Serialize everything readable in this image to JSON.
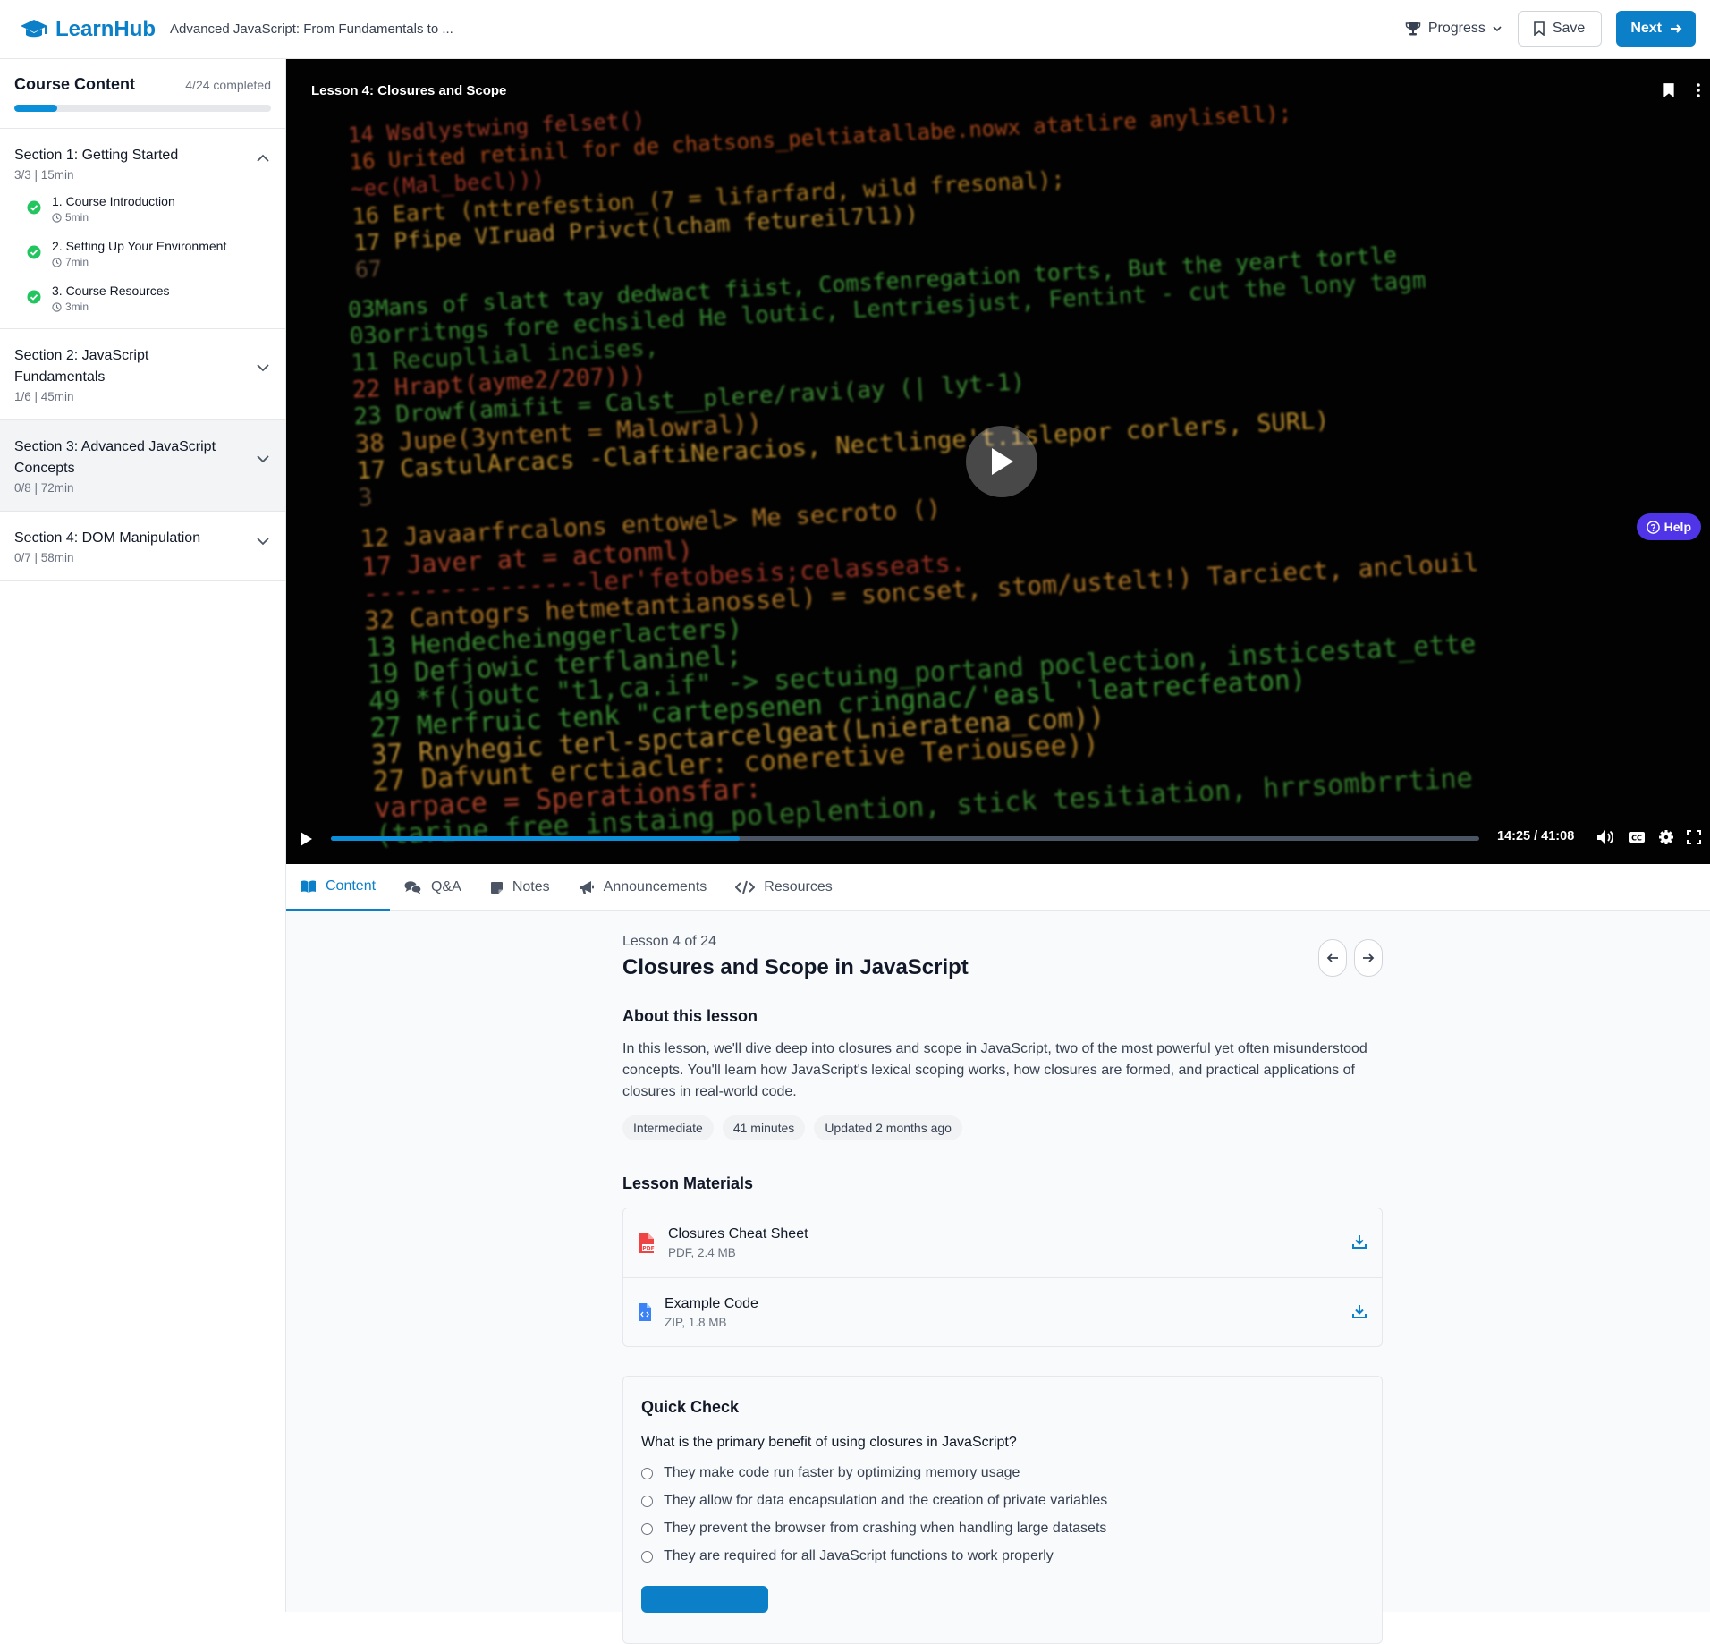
{
  "header": {
    "brand": "LearnHub",
    "course_title": "Advanced JavaScript: From Fundamentals to ...",
    "progress_label": "Progress",
    "save_label": "Save",
    "next_label": "Next"
  },
  "sidebar": {
    "title": "Course Content",
    "completed": "4/24 completed",
    "progress_fraction": 0.167,
    "sections": [
      {
        "title": "Section 1: Getting Started",
        "meta": "3/3 | 15min",
        "expanded": true,
        "lessons": [
          {
            "name": "1. Course Introduction",
            "duration": "5min",
            "done": true
          },
          {
            "name": "2. Setting Up Your Environment",
            "duration": "7min",
            "done": true
          },
          {
            "name": "3. Course Resources",
            "duration": "3min",
            "done": true
          }
        ]
      },
      {
        "title": "Section 2: JavaScript Fundamentals",
        "meta": "1/6 | 45min",
        "expanded": false
      },
      {
        "title": "Section 3: Advanced JavaScript Concepts",
        "meta": "0/8 | 72min",
        "expanded": false,
        "highlighted": true
      },
      {
        "title": "Section 4: DOM Manipulation",
        "meta": "0/7 | 58min",
        "expanded": false
      }
    ]
  },
  "video": {
    "title": "Lesson 4: Closures and Scope",
    "time": "14:25 / 41:08",
    "progress_fraction": 0.356,
    "help_label": "Help",
    "code_lines": [
      {
        "text": "14  Wsdlystwing felset()",
        "color": "#b8452d"
      },
      {
        "text": "16  Urited  retinil for de chatsons_peltiatallabe.nowx atatlire anylisell);",
        "color": "#c2531f"
      },
      {
        "text": "    ~ec(Mal_becl)))",
        "color": "#b33a2b"
      },
      {
        "text": "16  Eart (nttrefestion_(7 = lifarfard, wild fresonal);",
        "color": "#c9902a"
      },
      {
        "text": "17  Pfipe VIruad Privct(lcham fetureil7l1))",
        "color": "#d4a13a"
      },
      {
        "text": "67",
        "color": "#7a5a3a"
      },
      {
        "text": "03Mans of slatt tay dedwact fiist, Comsfenregation torts, But the yeart tortle",
        "color": "#45a83e"
      },
      {
        "text": "03orritngs fore echsiled He loutic, Lentriesjust, Fentint - cut the lony tagm",
        "color": "#3f9c3a"
      },
      {
        "text": "11  Recupllial incises,",
        "color": "#3e8f34"
      },
      {
        "text": "22  Hrapt(ayme2/207)))",
        "color": "#c44a2f"
      },
      {
        "text": "23  Drowf(amifit = Calst__plere/ravi(ay (| lyt-1)",
        "color": "#48a23f"
      },
      {
        "text": "38  Jupe(3yntent = Malowral))",
        "color": "#c9892e"
      },
      {
        "text": "17  CastulArcacs -ClaftiNeracios, Nectlinge't.islepor corlers, SURL)",
        "color": "#d6a234"
      },
      {
        "text": "3",
        "color": "#7a5a3a"
      },
      {
        "text": "12  Javaarfrcalons entowel> Me secroto ()",
        "color": "#c9892e"
      },
      {
        "text": "17  Javer at = actonml)",
        "color": "#c4492f"
      },
      {
        "text": "    ---------------ler'fetobesis;celasseats.",
        "color": "#b33a2b"
      },
      {
        "text": "32  Cantogrs hetmetantianossel) = soncset, stom/ustelt!) Tarciect, anclouil",
        "color": "#c9892e"
      },
      {
        "text": "13  Hendecheinggerlacters)",
        "color": "#46a23d"
      },
      {
        "text": "19  Defjowic terflaninel;",
        "color": "#48a23f"
      },
      {
        "text": "49  *f(joutc \"t1,ca.if\" -> sectuing_portand poclection, insticestat_ette",
        "color": "#3f9c3a"
      },
      {
        "text": "27  Merfruic tenk \"cartepsenen cringnac/'easl 'leatrecfeaton)",
        "color": "#45a83e"
      },
      {
        "text": "37  Rnyhegic terl-spctarcelgeat(Lnieratena_com))",
        "color": "#d4a13a"
      },
      {
        "text": "27  Dafvunt erctiacler: coneretive Teriousee))",
        "color": "#c9902a"
      },
      {
        "text": "    varpace = Sperationsfar:",
        "color": "#c44a2f"
      },
      {
        "text": "    (tarine free instaing_poleplention, stick tesitiation, hrrsombrrtine",
        "color": "#3e8f34"
      }
    ]
  },
  "tabs": [
    {
      "label": "Content",
      "icon": "book-icon",
      "active": true
    },
    {
      "label": "Q&A",
      "icon": "comments-icon",
      "active": false
    },
    {
      "label": "Notes",
      "icon": "sticky-note-icon",
      "active": false
    },
    {
      "label": "Announcements",
      "icon": "megaphone-icon",
      "active": false
    },
    {
      "label": "Resources",
      "icon": "code-icon",
      "active": false
    }
  ],
  "lesson": {
    "position": "Lesson 4 of 24",
    "title": "Closures and Scope in JavaScript",
    "about_heading": "About this lesson",
    "about_text": "In this lesson, we'll dive deep into closures and scope in JavaScript, two of the most powerful yet often misunderstood concepts. You'll learn how JavaScript's lexical scoping works, how closures are formed, and practical applications of closures in real-world code.",
    "tags": [
      "Intermediate",
      "41 minutes",
      "Updated 2 months ago"
    ]
  },
  "materials": {
    "heading": "Lesson Materials",
    "items": [
      {
        "name": "Closures Cheat Sheet",
        "meta": "PDF, 2.4 MB",
        "icon": "pdf-file-icon"
      },
      {
        "name": "Example Code",
        "meta": "ZIP, 1.8 MB",
        "icon": "code-file-icon"
      }
    ]
  },
  "quiz": {
    "heading": "Quick Check",
    "question": "What is the primary benefit of using closures in JavaScript?",
    "options": [
      "They make code run faster by optimizing memory usage",
      "They allow for data encapsulation and the creation of private variables",
      "They prevent the browser from crashing when handling large datasets",
      "They are required for all JavaScript functions to work properly"
    ]
  },
  "colors": {
    "brand": "#0b7fc7",
    "progress": "#0b8fd9",
    "help": "#4f34e8",
    "check": "#22c55e"
  }
}
